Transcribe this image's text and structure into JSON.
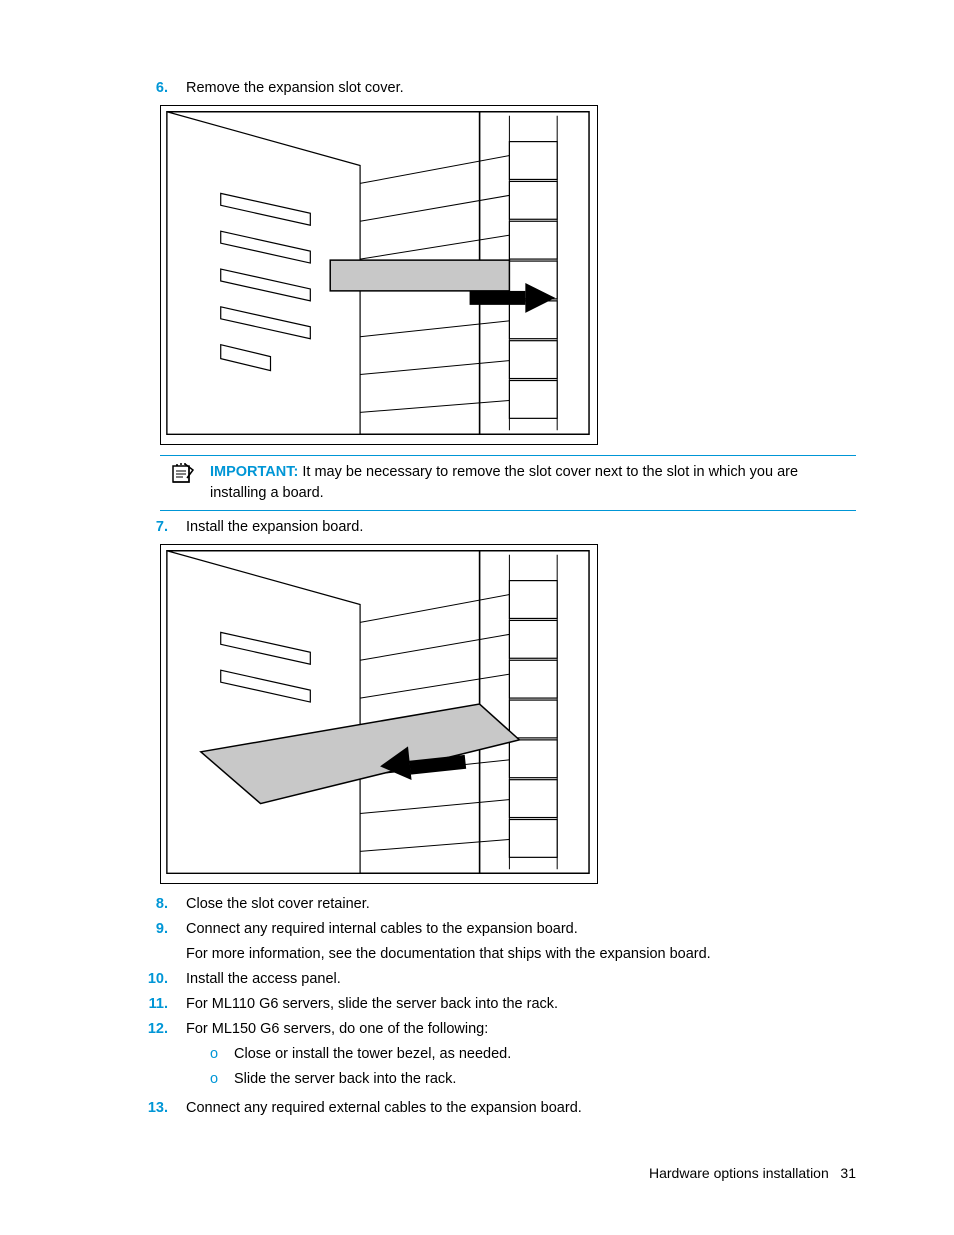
{
  "steps": {
    "s6": {
      "num": "6.",
      "text": "Remove the expansion slot cover."
    },
    "s7": {
      "num": "7.",
      "text": "Install the expansion board."
    },
    "s8": {
      "num": "8.",
      "text": "Close the slot cover retainer."
    },
    "s9": {
      "num": "9.",
      "text": "Connect any required internal cables to the expansion board.",
      "sub": "For more information, see the documentation that ships with the expansion board."
    },
    "s10": {
      "num": "10.",
      "text": "Install the access panel."
    },
    "s11": {
      "num": "11.",
      "text": "For ML110 G6 servers, slide the server back into the rack."
    },
    "s12": {
      "num": "12.",
      "text": "For ML150 G6 servers, do one of the following:"
    },
    "s12a": {
      "bullet": "o",
      "text": "Close or install the tower bezel, as needed."
    },
    "s12b": {
      "bullet": "o",
      "text": "Slide the server back into the rack."
    },
    "s13": {
      "num": "13.",
      "text": "Connect any required external cables to the expansion board."
    }
  },
  "callout": {
    "label": "IMPORTANT:",
    "text": "  It may be necessary to remove the slot cover next to the slot in which you are installing a board."
  },
  "footer": {
    "section": "Hardware options installation",
    "page": "31"
  }
}
